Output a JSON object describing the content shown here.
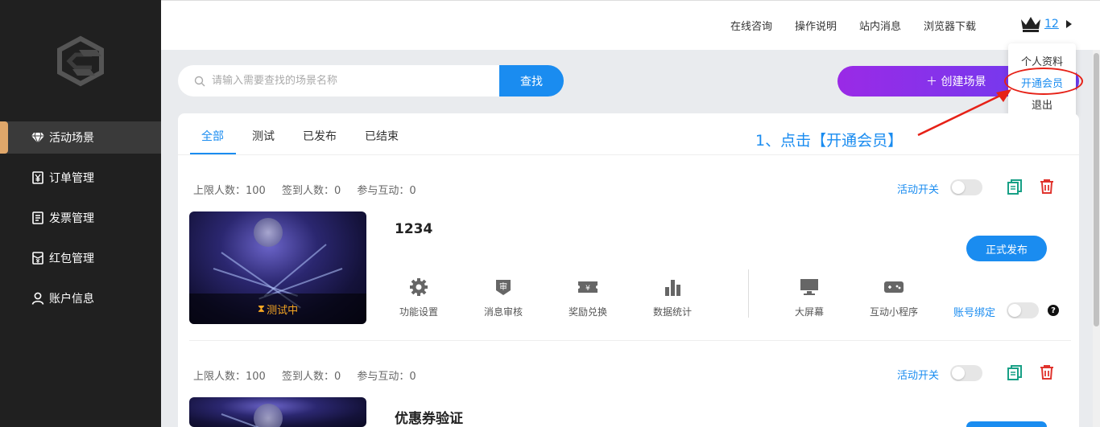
{
  "sidebar": {
    "items": [
      {
        "label": "活动场景",
        "icon": "diamond-icon",
        "active": true
      },
      {
        "label": "订单管理",
        "icon": "yen-doc-icon"
      },
      {
        "label": "发票管理",
        "icon": "invoice-icon"
      },
      {
        "label": "红包管理",
        "icon": "red-packet-icon"
      },
      {
        "label": "账户信息",
        "icon": "user-icon"
      }
    ]
  },
  "topbar": {
    "links": [
      "在线咨询",
      "操作说明",
      "站内消息",
      "浏览器下载"
    ],
    "vip_count": "12"
  },
  "dropdown": {
    "items": [
      "个人资料",
      "开通会员",
      "退出"
    ],
    "highlighted": "开通会员"
  },
  "search": {
    "placeholder": "请输入需要查找的场景名称",
    "button": "查找"
  },
  "create_button": "＋ 创建场景",
  "tabs": [
    "全部",
    "测试",
    "已发布",
    "已结束"
  ],
  "annotation": "1、点击【开通会员】",
  "colors": {
    "accent": "#1a8cf0",
    "create_gradient_start": "#9a2ae6",
    "create_gradient_end": "#6a3ef0",
    "sidebar_bg": "#202020",
    "active_marker": "#e0a76a",
    "annotation_red": "#e62117",
    "testing_status": "#f5a623"
  },
  "scenes": [
    {
      "stats": [
        "上限人数：100",
        "签到人数：0",
        "参与互动：0"
      ],
      "switch_label": "活动开关",
      "title": "1234",
      "status": "测试中",
      "features": [
        "功能设置",
        "消息审核",
        "奖励兑换",
        "数据统计"
      ],
      "extras": [
        "大屏幕",
        "互动小程序"
      ],
      "publish_button": "正式发布",
      "bind_label": "账号绑定"
    },
    {
      "stats": [
        "上限人数：100",
        "签到人数：0",
        "参与互动：0"
      ],
      "switch_label": "活动开关",
      "title": "优惠券验证"
    }
  ]
}
